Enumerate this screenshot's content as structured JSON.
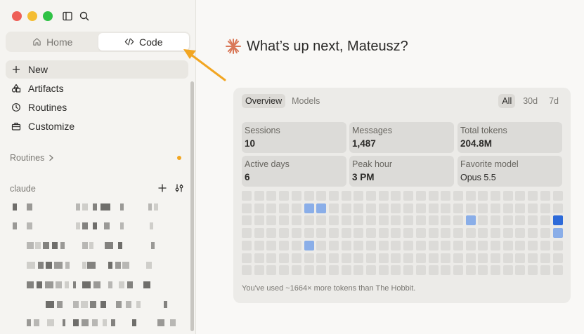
{
  "sidebar": {
    "segment": [
      {
        "label": "Home",
        "icon": "home-icon",
        "active": false
      },
      {
        "label": "Code",
        "icon": "code-icon",
        "active": true
      }
    ],
    "nav": [
      {
        "label": "New",
        "icon": "plus-icon",
        "active": true
      },
      {
        "label": "Artifacts",
        "icon": "artifacts-icon",
        "active": false
      },
      {
        "label": "Routines",
        "icon": "clock-icon",
        "active": false
      },
      {
        "label": "Customize",
        "icon": "briefcase-icon",
        "active": false
      }
    ],
    "routines_section": "Routines",
    "project_section": "claude"
  },
  "main": {
    "greeting": "What’s up next, Mateusz?",
    "stats_card": {
      "tabs": [
        "Overview",
        "Models"
      ],
      "ranges": [
        "All",
        "30d",
        "7d"
      ],
      "stats": [
        {
          "label": "Sessions",
          "value": "10"
        },
        {
          "label": "Messages",
          "value": "1,487"
        },
        {
          "label": "Total tokens",
          "value": "204.8M"
        },
        {
          "label": "Active days",
          "value": "6"
        },
        {
          "label": "Peak hour",
          "value": "3 PM"
        },
        {
          "label": "Favorite model",
          "value": "Opus 5.5"
        }
      ],
      "heatmap_active": [
        {
          "col": 5,
          "row": 1,
          "level": 1
        },
        {
          "col": 6,
          "row": 1,
          "level": 1
        },
        {
          "col": 5,
          "row": 4,
          "level": 1
        },
        {
          "col": 18,
          "row": 2,
          "level": 1
        },
        {
          "col": 25,
          "row": 2,
          "level": 2
        },
        {
          "col": 25,
          "row": 3,
          "level": 1
        }
      ],
      "footnote": "You've used ~1664× more tokens than The Hobbit."
    }
  },
  "colors": {
    "accent_orange": "#d97757",
    "annotation_arrow": "#f2a622",
    "heat_low": "#8aaee8",
    "heat_high": "#2d6ad9"
  }
}
